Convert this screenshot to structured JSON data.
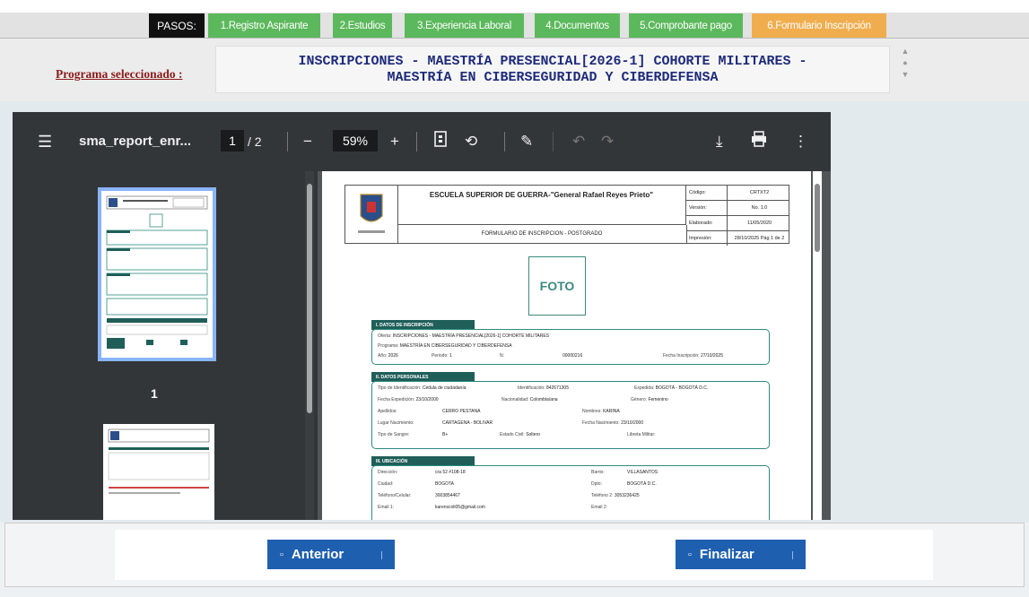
{
  "steps": {
    "pasos_label": "PASOS:",
    "items": [
      {
        "label": "1.Registro Aspirante",
        "state": "done"
      },
      {
        "label": "2.Estudios",
        "state": "done"
      },
      {
        "label": "3.Experiencia Laboral",
        "state": "done"
      },
      {
        "label": "4.Documentos",
        "state": "done"
      },
      {
        "label": "5.Comprobante pago",
        "state": "done"
      },
      {
        "label": "6.Formulario Inscripción",
        "state": "active"
      }
    ],
    "colors": {
      "done": "#5cb85c",
      "active": "#f0ad4e"
    }
  },
  "program": {
    "label": "Programa seleccionado :",
    "line1": "INSCRIPCIONES - MAESTRÍA PRESENCIAL[2026-1] COHORTE MILITARES -",
    "line2": "MAESTRÍA EN CIBERSEGURIDAD Y CIBERDEFENSA"
  },
  "viewer": {
    "doc_name": "sma_report_enr...",
    "current_page": "1",
    "total_pages": "/ 2",
    "zoom": "59%",
    "thumb_page_number": "1"
  },
  "document": {
    "institution": "ESCUELA SUPERIOR DE GUERRA-\"General Rafael Reyes Prieto\"",
    "form_title": "FORMULARIO DE INSCRIPCION - POSTGRADO",
    "meta": [
      {
        "k": "Código:",
        "v": "CRTXT2"
      },
      {
        "k": "Versión:",
        "v": "No. 1.0"
      },
      {
        "k": "Elaborado:",
        "v": "11/05/2020"
      },
      {
        "k": "Impresión:",
        "v": "28/10/2025 Pág 1 de 2"
      }
    ],
    "photo_label": "FOTO",
    "sec1": {
      "title": "I. DATOS DE INSCRIPCIÓN",
      "oferta_label": "Oferta:",
      "oferta": "INSCRIPCIONES - MAESTRÍA PRESENCIAL[2026-1] COHORTE MILITARES",
      "programa_label": "Programa:",
      "programa": "MAESTRÍA EN CIBERSEGURIDAD Y CIBERDEFENSA",
      "anio_label": "Año:",
      "anio": "2026",
      "periodo_label": "Periodo:",
      "periodo": "1",
      "n_label": "N:",
      "n": "00000216",
      "fecha_label": "Fecha Inscripción:",
      "fecha": "27/10/2025"
    },
    "sec2": {
      "title": "II. DATOS PERSONALES",
      "tipo_id_label": "Tipo de Identificación:",
      "tipo_id": "Cédula de ciudadanía",
      "ident_label": "Identificación:",
      "ident": "842671305",
      "expedida_label": "Expedida:",
      "expedida": "BOGOTÁ - BOGOTÁ D.C.",
      "fecha_exp_label": "Fecha Expedición:",
      "fecha_exp": "23/10/2000",
      "nacionalidad_label": "Nacionalidad:",
      "nacionalidad": "Colombia/ana",
      "genero_label": "Género:",
      "genero": "Femenino",
      "apellidos_label": "Apellidos:",
      "apellidos": "CERRO PESTANA",
      "nombres_label": "Nombres:",
      "nombres": "KARINA",
      "lugar_nac_label": "Lugar Nacimiento:",
      "lugar_nac": "CARTAGENA - BOLIVAR",
      "fecha_nac_label": "Fecha Nacimiento:",
      "fecha_nac": "23/10/2000",
      "sangre_label": "Tipo de Sangre:",
      "sangre": "B+",
      "civil_label": "Estado Civil:",
      "civil": "Soltero",
      "libreta_label": "Libreta Militar:"
    },
    "sec3": {
      "title": "III. UBICACIÓN",
      "direccion_label": "Dirección:",
      "direccion": "cra 52 #108-18",
      "barrio_label": "Barrio:",
      "barrio": "VILLASANTOS",
      "ciudad_label": "Ciudad:",
      "ciudad": "BOGOTA",
      "dpto_label": "Dpto:",
      "dpto": "BOGOTÁ D.C.",
      "tel_label": "Teléfono/Celular:",
      "tel": "3003854467",
      "tel2_label": "Teléfono 2:",
      "tel2": "3053236425",
      "email_label": "Email 1:",
      "email": "karenscoli05@gmail.com",
      "email2_label": "Email 2:"
    }
  },
  "buttons": {
    "prev": "Anterior",
    "finish": "Finalizar"
  }
}
